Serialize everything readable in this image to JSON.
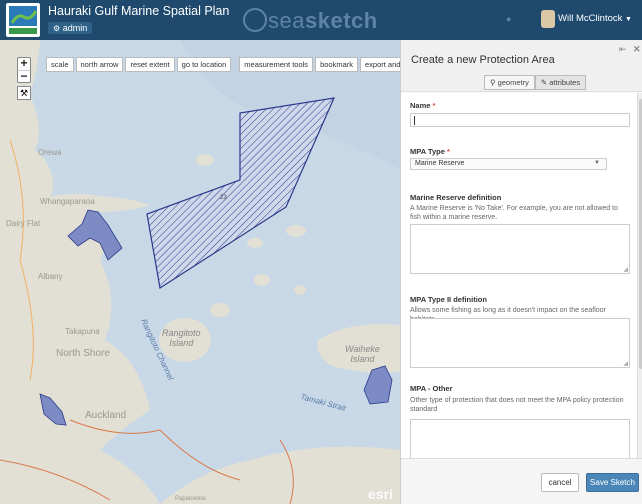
{
  "header": {
    "app_title": "Hauraki Gulf Marine Spatial Plan",
    "role_badge": "admin",
    "brand_left": "sea",
    "brand_right": "sketch",
    "user_name": "Will McClintock",
    "colors": {
      "bar": "#1f4a6e",
      "brand": "#5d84a5"
    }
  },
  "map": {
    "zoom_in": "+",
    "zoom_out": "−",
    "toolbar": [
      "scale",
      "north arrow",
      "reset extent",
      "go to location",
      "measurement tools",
      "bookmark",
      "export and print"
    ],
    "labels": {
      "orewa": "Orewa",
      "whangaparaoa": "Whangaparaoa",
      "dairy_flat": "Dairy Flat",
      "albany": "Albany",
      "takapuna": "Takapuna",
      "north_shore": "North Shore",
      "auckland": "Auckland",
      "rangitoto_island": "Rangitoto\nIsland",
      "rangitoto_channel": "Rangitoto Channel",
      "waiheke_island": "Waiheke\nIsland",
      "tamaki_strait": "Tamaki Strait",
      "papatoetoe": "Papatoetoe",
      "panel_label": "23",
      "esri": "esri"
    },
    "colors": {
      "sea": "#c8d8e6",
      "land": "#e2dfd5",
      "mpa_fill": "#7d8bc4",
      "hatch": "#2b3a8a"
    }
  },
  "panel": {
    "title": "Create a new Protection Area",
    "tabs": [
      {
        "icon": "map-marker-icon",
        "label": "geometry"
      },
      {
        "icon": "edit-icon",
        "label": "attributes"
      }
    ],
    "fields": {
      "name_label": "Name",
      "required_mark": "*",
      "mpa_type_label": "MPA Type",
      "mpa_type_value": "Marine Reserve",
      "marine_reserve_label": "Marine Reserve definition",
      "marine_reserve_help": "A Marine Reserve is 'No Take'. For example, you are not allowed to fish within a marine reserve.",
      "mpa_type_ii_label": "MPA Type II definition",
      "mpa_type_ii_help": "Allows some fishing as long as it doesn't impact on the seafloor habitats",
      "mpa_other_label": "MPA - Other",
      "mpa_other_help": "Other type of protection that does not meet the MPA policy protection standard"
    },
    "buttons": {
      "cancel": "cancel",
      "save": "Save Sketch"
    }
  }
}
